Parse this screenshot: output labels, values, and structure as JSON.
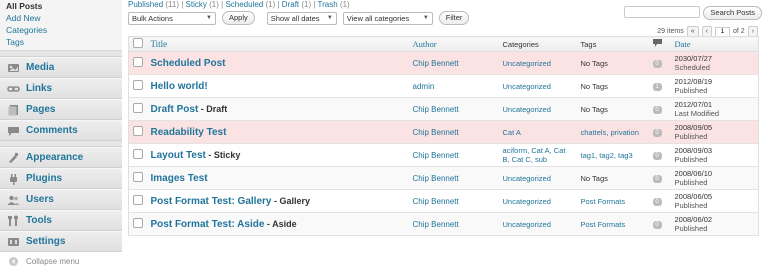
{
  "sidebar": {
    "submenu": [
      "All Posts",
      "Add New",
      "Categories",
      "Tags"
    ],
    "menu": [
      {
        "label": "Media",
        "icon": "media-icon"
      },
      {
        "label": "Links",
        "icon": "links-icon"
      },
      {
        "label": "Pages",
        "icon": "pages-icon"
      },
      {
        "label": "Comments",
        "icon": "comments-icon"
      },
      {
        "label": "Appearance",
        "icon": "appearance-icon"
      },
      {
        "label": "Plugins",
        "icon": "plugins-icon"
      },
      {
        "label": "Users",
        "icon": "users-icon"
      },
      {
        "label": "Tools",
        "icon": "tools-icon"
      },
      {
        "label": "Settings",
        "icon": "settings-icon"
      }
    ],
    "collapse": "Collapse menu"
  },
  "filters": {
    "published": "Published",
    "published_count": "(11)",
    "sticky": "Sticky",
    "sticky_count": "(1)",
    "scheduled": "Scheduled",
    "scheduled_count": "(1)",
    "draft": "Draft",
    "draft_count": "(1)",
    "trash": "Trash",
    "trash_count": "(1)"
  },
  "toolbar": {
    "bulk_actions": "Bulk Actions",
    "apply": "Apply",
    "dates": "Show all dates",
    "categories": "View all categories",
    "filter": "Filter"
  },
  "search": {
    "button": "Search Posts"
  },
  "pagination": {
    "items": "29 items",
    "first": "«",
    "prev": "‹",
    "current": "1",
    "of": "of 2",
    "next": "›"
  },
  "columns": {
    "title": "Title",
    "author": "Author",
    "categories": "Categories",
    "tags": "Tags",
    "date": "Date"
  },
  "posts": [
    {
      "title": "Scheduled Post",
      "state": "",
      "author": "Chip Bennett",
      "categories": "Uncategorized",
      "tags": "No Tags",
      "comments": "0",
      "date": "2030/07/27",
      "status": "Scheduled"
    },
    {
      "title": "Hello world!",
      "state": "",
      "author": "admin",
      "categories": "Uncategorized",
      "tags": "No Tags",
      "comments": "1",
      "date": "2012/08/19",
      "status": "Published"
    },
    {
      "title": "Draft Post",
      "state": " - Draft",
      "author": "Chip Bennett",
      "categories": "Uncategorized",
      "tags": "No Tags",
      "comments": "0",
      "date": "2012/07/01",
      "status": "Last Modified"
    },
    {
      "title": "Readability Test",
      "state": "",
      "author": "Chip Bennett",
      "categories": "Cat A",
      "tags": "chattels, privation",
      "comments": "0",
      "date": "2008/09/05",
      "status": "Published"
    },
    {
      "title": "Layout Test",
      "state": " - Sticky",
      "author": "Chip Bennett",
      "categories": "aciform, Cat A, Cat B, Cat C, sub",
      "tags": "tag1, tag2, tag3",
      "comments": "0",
      "date": "2008/09/03",
      "status": "Published"
    },
    {
      "title": "Images Test",
      "state": "",
      "author": "Chip Bennett",
      "categories": "Uncategorized",
      "tags": "No Tags",
      "comments": "0",
      "date": "2008/06/10",
      "status": "Published"
    },
    {
      "title": "Post Format Test: Gallery",
      "state": " - Gallery",
      "author": "Chip Bennett",
      "categories": "Uncategorized",
      "tags": "Post Formats",
      "comments": "0",
      "date": "2008/06/05",
      "status": "Published"
    },
    {
      "title": "Post Format Test: Aside",
      "state": " - Aside",
      "author": "Chip Bennett",
      "categories": "Uncategorized",
      "tags": "Post Formats",
      "comments": "0",
      "date": "2008/06/02",
      "status": "Published"
    }
  ],
  "colors": {
    "link": "#21759b",
    "scheduled_row": "#fbe2e3",
    "sidebar_bg": "#e6e6e6"
  }
}
